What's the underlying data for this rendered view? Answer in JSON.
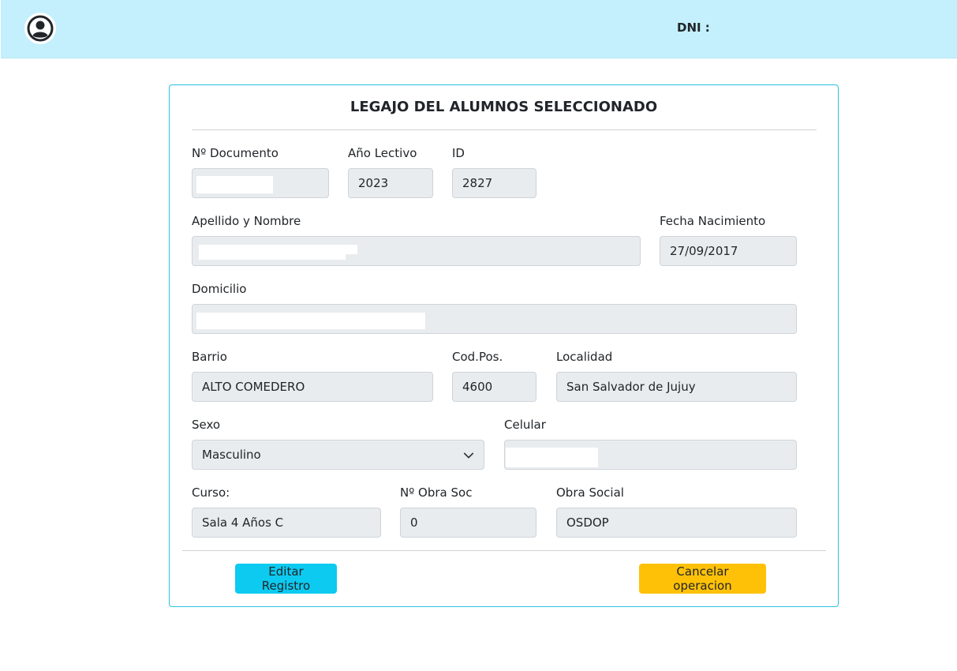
{
  "header": {
    "avatar_icon": "user-circle-icon",
    "dni_label": "DNI :"
  },
  "card": {
    "title": "LEGAJO DEL ALUMNOS SELECCIONADO"
  },
  "form": {
    "documento": {
      "label": "Nº Documento",
      "value": ""
    },
    "anio_lectivo": {
      "label": "Año Lectivo",
      "value": "2023"
    },
    "id": {
      "label": "ID",
      "value": "2827"
    },
    "apellido_nombre": {
      "label": "Apellido y Nombre",
      "value": ""
    },
    "fecha_nacimiento": {
      "label": "Fecha Nacimiento",
      "value": "27/09/2017"
    },
    "domicilio": {
      "label": "Domicilio",
      "value": ""
    },
    "barrio": {
      "label": "Barrio",
      "value": "ALTO COMEDERO"
    },
    "cod_pos": {
      "label": "Cod.Pos.",
      "value": "4600"
    },
    "localidad": {
      "label": "Localidad",
      "value": "San Salvador de Jujuy"
    },
    "sexo": {
      "label": "Sexo",
      "value": "Masculino"
    },
    "celular": {
      "label": "Celular",
      "value": ""
    },
    "curso": {
      "label": "Curso:",
      "value": "Sala 4 Años C"
    },
    "obra_soc_num": {
      "label": "Nº Obra Soc",
      "value": "0"
    },
    "obra_social": {
      "label": "Obra Social",
      "value": "OSDOP"
    }
  },
  "actions": {
    "edit_label": "Editar Registro",
    "cancel_label": "Cancelar operacion"
  },
  "colors": {
    "header_bg": "#c3f0fc",
    "card_border": "#2bc2dd",
    "edit_button": "#0dcaf0",
    "cancel_button": "#ffc107",
    "input_bg": "#e9ecef"
  }
}
